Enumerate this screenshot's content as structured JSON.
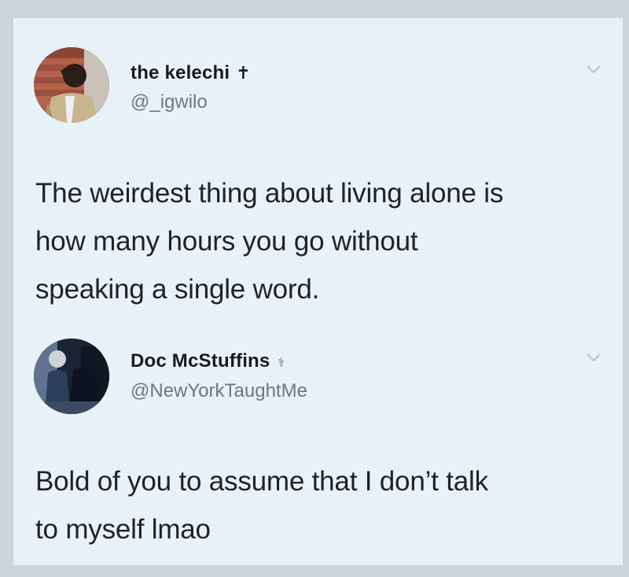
{
  "tweets": [
    {
      "display_name": "the kelechi",
      "name_badge": "✝",
      "handle": "@_igwilo",
      "text_lines": [
        "The weirdest thing about living alone is",
        "how many hours you go without",
        "speaking a single word."
      ],
      "avatar_icon": "profile-photo",
      "menu_icon": "chevron-down-icon"
    },
    {
      "display_name": "Doc McStuffins",
      "name_badge": "⚕",
      "handle": "@NewYorkTaughtMe",
      "text_lines": [
        "Bold of you to assume that I don’t talk",
        "to myself lmao"
      ],
      "avatar_icon": "profile-photo",
      "menu_icon": "chevron-down-icon"
    }
  ],
  "colors": {
    "card_background": "#e8f1f8",
    "outer_background": "#c9d4dc",
    "primary_text": "#222222",
    "secondary_text": "#6e7780"
  }
}
